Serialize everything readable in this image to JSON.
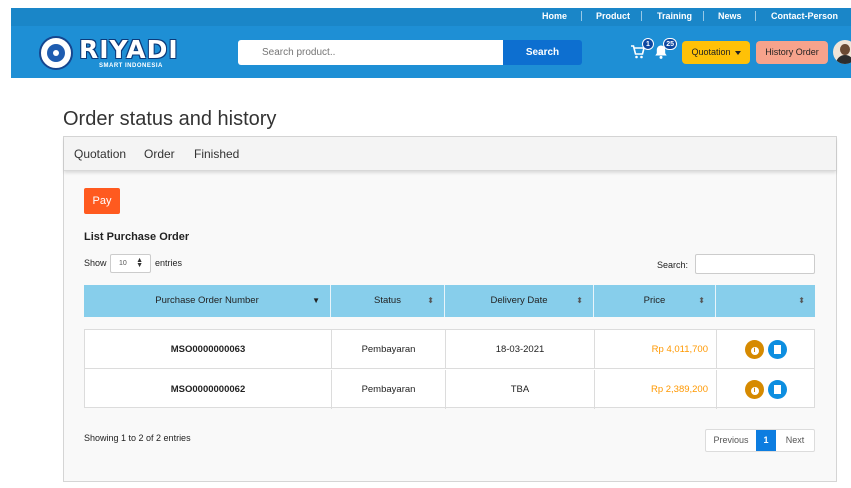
{
  "topnav": {
    "links": [
      "Home",
      "Product",
      "Training",
      "News",
      "Contact-Person"
    ]
  },
  "header": {
    "brand": "RIYADI",
    "brand_sub": "SMART INDONESIA",
    "search_placeholder": "Search product..",
    "search_button": "Search",
    "cart_count": "1",
    "notification_count": "25",
    "quotation_button": "Quotation",
    "history_button": "History Order",
    "icons": [
      "cart-icon",
      "bell-icon",
      "caret-down-icon",
      "avatar"
    ],
    "colors": {
      "nav_bg": "#1a86c8",
      "header_bg": "#1e8fd5",
      "search_btn": "#0d6fd0",
      "quotation": "#ffc107",
      "history": "#f7a38c"
    }
  },
  "main": {
    "title": "Order status and history",
    "tabs": [
      "Quotation",
      "Order",
      "Finished"
    ],
    "pay_button": "Pay",
    "list_title": "List Purchase Order",
    "show_label": "Show",
    "entries_value": "10",
    "entries_label": "entries",
    "search_label": "Search:",
    "table": {
      "columns": [
        "Purchase Order Number",
        "Status",
        "Delivery Date",
        "Price",
        ""
      ],
      "rows": [
        {
          "po_number": "MSO0000000063",
          "status": "Pembayaran",
          "delivery_date": "18-03-2021",
          "price": "Rp 4,011,700"
        },
        {
          "po_number": "MSO0000000062",
          "status": "Pembayaran",
          "delivery_date": "TBA",
          "price": "Rp 2,389,200"
        }
      ],
      "row_actions": [
        "info-icon",
        "document-icon"
      ]
    },
    "showing_text": "Showing 1 to 2 of 2 entries",
    "pagination": {
      "previous": "Previous",
      "current": "1",
      "next": "Next"
    },
    "colors": {
      "pay": "#ff5a1f",
      "table_header": "#87ceeb",
      "price": "#ff9800",
      "info": "#d68a00",
      "doc": "#0d8ee0",
      "active_page": "#0d7de0"
    }
  }
}
